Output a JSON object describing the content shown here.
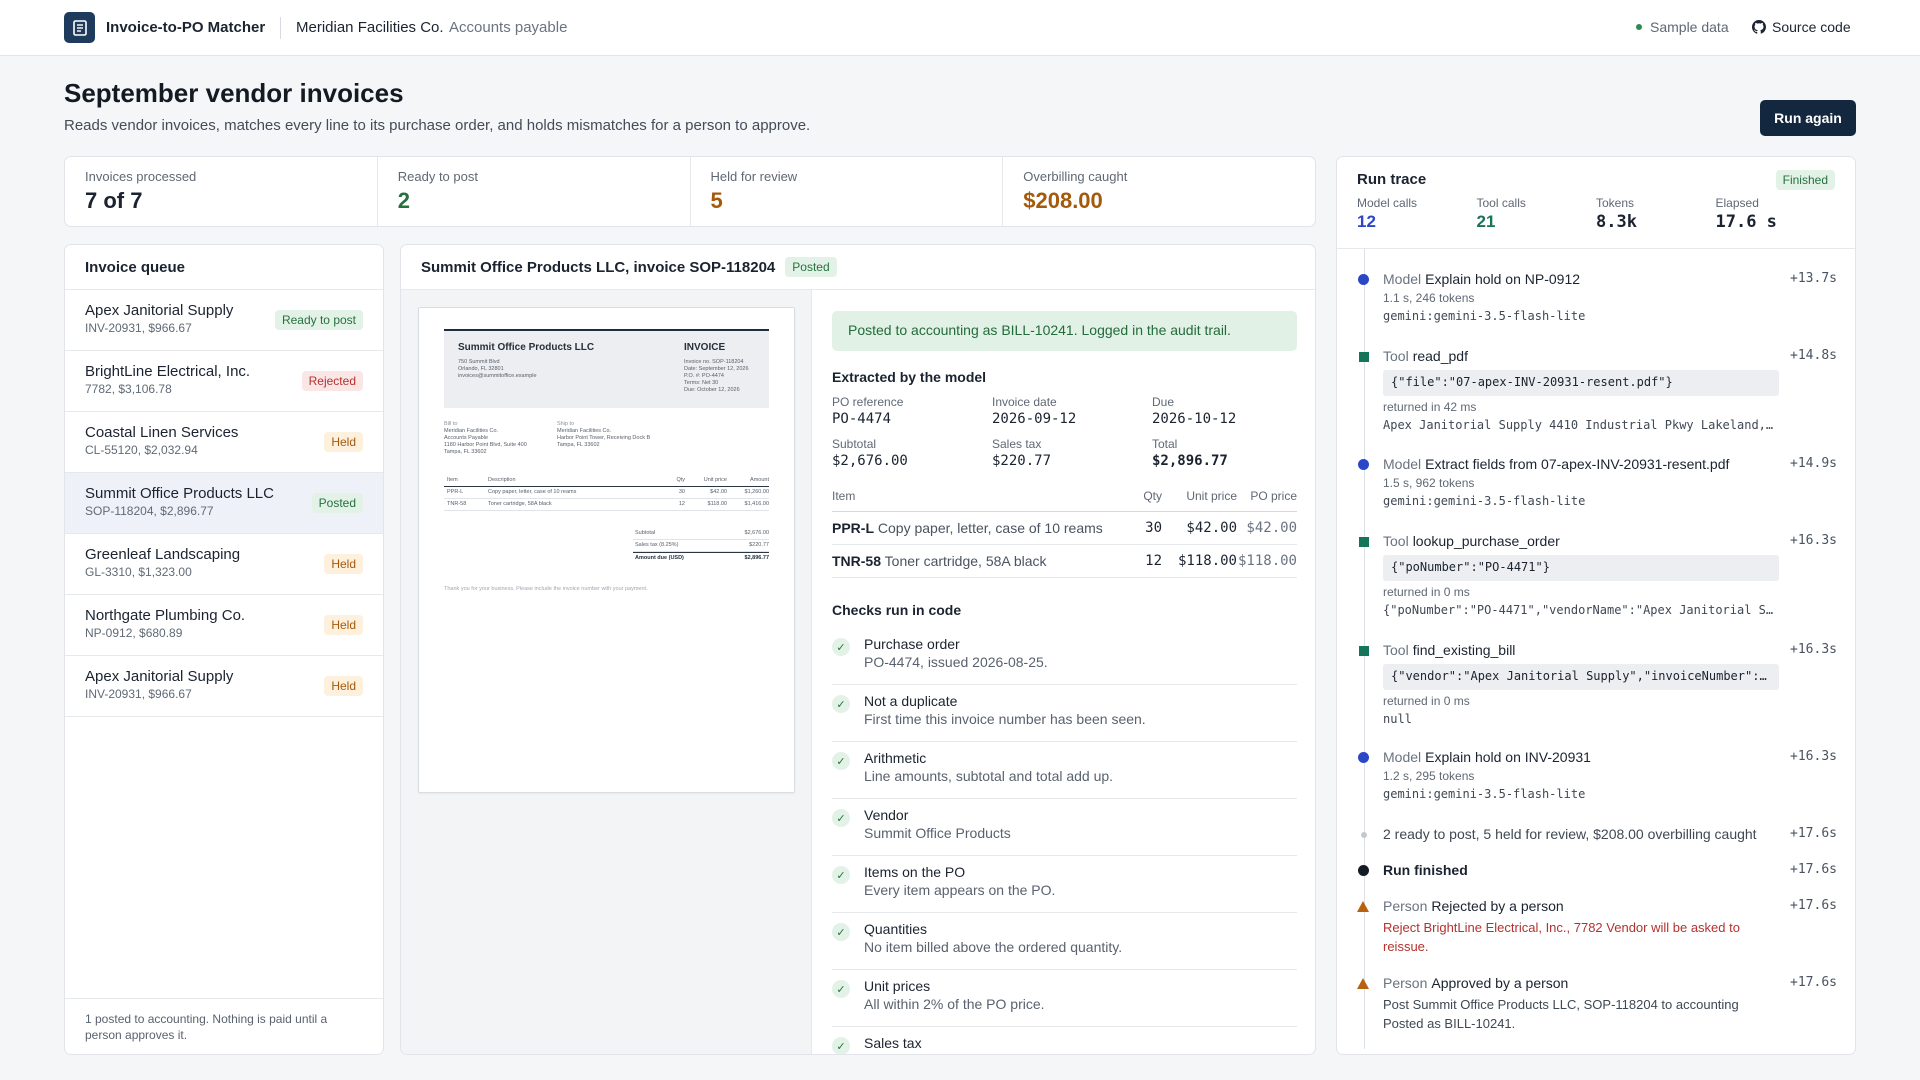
{
  "app": {
    "name": "Invoice-to-PO Matcher",
    "company": "Meridian Facilities Co.",
    "dept": "Accounts payable",
    "sample": "Sample data",
    "source": "Source code"
  },
  "header": {
    "title": "September vendor invoices",
    "subtitle": "Reads vendor invoices, matches every line to its purchase order, and holds mismatches for a person to approve.",
    "run_again": "Run again"
  },
  "stats": [
    {
      "label": "Invoices processed",
      "value": "7 of 7",
      "color": "#1b2330"
    },
    {
      "label": "Ready to post",
      "value": "2",
      "color": "#27703f"
    },
    {
      "label": "Held for review",
      "value": "5",
      "color": "#a5590b"
    },
    {
      "label": "Overbilling caught",
      "value": "$208.00",
      "color": "#a5590b"
    }
  ],
  "queue": {
    "title": "Invoice queue",
    "items": [
      {
        "name": "Apex Janitorial Supply",
        "meta": "INV-20931, $966.67",
        "status": "Ready to post"
      },
      {
        "name": "BrightLine Electrical, Inc.",
        "meta": "7782, $3,106.78",
        "status": "Rejected"
      },
      {
        "name": "Coastal Linen Services",
        "meta": "CL-55120, $2,032.94",
        "status": "Held"
      },
      {
        "name": "Summit Office Products LLC",
        "meta": "SOP-118204, $2,896.77",
        "status": "Posted"
      },
      {
        "name": "Greenleaf Landscaping",
        "meta": "GL-3310, $1,323.00",
        "status": "Held"
      },
      {
        "name": "Northgate Plumbing Co.",
        "meta": "NP-0912, $680.89",
        "status": "Held"
      },
      {
        "name": "Apex Janitorial Supply",
        "meta": "INV-20931, $966.67",
        "status": "Held"
      }
    ],
    "footer": "1 posted to accounting. Nothing is paid until a person approves it."
  },
  "detail": {
    "title": "Summit Office Products LLC, invoice SOP-118204",
    "status": "Posted",
    "alert": "Posted to accounting as BILL-10241. Logged in the audit trail.",
    "extracted_title": "Extracted by the model",
    "fields": [
      {
        "label": "PO reference",
        "value": "PO-4474"
      },
      {
        "label": "Invoice date",
        "value": "2026-09-12"
      },
      {
        "label": "Due",
        "value": "2026-10-12"
      },
      {
        "label": "Subtotal",
        "value": "$2,676.00"
      },
      {
        "label": "Sales tax",
        "value": "$220.77"
      },
      {
        "label": "Total",
        "value": "$2,896.77"
      }
    ],
    "table_headers": {
      "item": "Item",
      "qty": "Qty",
      "unit": "Unit price",
      "po": "PO price"
    },
    "items": [
      {
        "code": "PPR-L",
        "desc": "Copy paper, letter, case of 10 reams",
        "qty": "30",
        "unit": "$42.00",
        "po": "$42.00"
      },
      {
        "code": "TNR-58",
        "desc": "Toner cartridge, 58A black",
        "qty": "12",
        "unit": "$118.00",
        "po": "$118.00"
      }
    ],
    "checks_title": "Checks run in code",
    "checks": [
      {
        "title": "Purchase order",
        "desc": "PO-4474, issued 2026-08-25."
      },
      {
        "title": "Not a duplicate",
        "desc": "First time this invoice number has been seen."
      },
      {
        "title": "Arithmetic",
        "desc": "Line amounts, subtotal and total add up."
      },
      {
        "title": "Vendor",
        "desc": "Summit Office Products"
      },
      {
        "title": "Items on the PO",
        "desc": "Every item appears on the PO."
      },
      {
        "title": "Quantities",
        "desc": "No item billed above the ordered quantity."
      },
      {
        "title": "Unit prices",
        "desc": "All within 2% of the PO price."
      },
      {
        "title": "Sales tax",
        "desc": ""
      }
    ]
  },
  "document": {
    "vendor": "Summit Office Products LLC",
    "addr1": "750 Summit Blvd",
    "addr2": "Orlando, FL 32801",
    "addr3": "invoices@summitoffice.example",
    "heading": "INVOICE",
    "meta1": "Invoice no. SOP-118204",
    "meta2": "Date: September 12, 2026",
    "meta3": "P.O. #: PO-4474",
    "meta4": "Terms: Net 30",
    "meta5": "Due: October 12, 2026",
    "bill_label": "Bill to",
    "bill1": "Meridian Facilities Co.",
    "bill2": "Accounts Payable",
    "bill3": "1180 Harbor Point Blvd, Suite 400",
    "bill4": "Tampa, FL 33602",
    "ship_label": "Ship to",
    "ship1": "Meridian Facilities Co.",
    "ship2": "Harbor Point Tower, Receiving Dock B",
    "ship3": "Tampa, FL 33602",
    "col_item": "Item",
    "col_desc": "Description",
    "col_qty": "Qty",
    "col_unit": "Unit price",
    "col_amt": "Amount",
    "lines": [
      {
        "item": "PPR-L",
        "desc": "Copy paper, letter, case of 10 reams",
        "qty": "30",
        "unit": "$42.00",
        "amt": "$1,260.00"
      },
      {
        "item": "TNR-58",
        "desc": "Toner cartridge, 58A black",
        "qty": "12",
        "unit": "$118.00",
        "amt": "$1,416.00"
      }
    ],
    "subtotal_label": "Subtotal",
    "subtotal": "$2,676.00",
    "tax_label": "Sales tax (8.25%)",
    "tax": "$220.77",
    "due_label": "Amount due (USD)",
    "due": "$2,896.77",
    "thanks": "Thank you for your business. Please include the invoice number with your payment."
  },
  "trace": {
    "title": "Run trace",
    "status": "Finished",
    "stats": [
      {
        "label": "Model calls",
        "value": "12",
        "color": "#2a47c9"
      },
      {
        "label": "Tool calls",
        "value": "21",
        "color": "#16745a"
      },
      {
        "label": "Tokens",
        "value": "8.3k",
        "color": "#1b2330"
      },
      {
        "label": "Elapsed",
        "value": "17.6 s",
        "color": "#1b2330"
      }
    ],
    "events": [
      {
        "kind": "Model",
        "title": "Explain hold on NP-0912",
        "time": "+13.7s",
        "sub": "1.1 s, 246 tokens",
        "out": "gemini:gemini-3.5-flash-lite"
      },
      {
        "kind": "Tool",
        "title": "read_pdf",
        "time": "+14.8s",
        "code": "{\"file\":\"07-apex-INV-20931-resent.pdf\"}",
        "sub": "returned in 42 ms",
        "out": "Apex Janitorial Supply 4410 Industrial Pkwy Lakeland,…"
      },
      {
        "kind": "Model",
        "title": "Extract fields from 07-apex-INV-20931-resent.pdf",
        "time": "+14.9s",
        "sub": "1.5 s, 962 tokens",
        "out": "gemini:gemini-3.5-flash-lite"
      },
      {
        "kind": "Tool",
        "title": "lookup_purchase_order",
        "time": "+16.3s",
        "code": "{\"poNumber\":\"PO-4471\"}",
        "sub": "returned in 0 ms",
        "out": "{\"poNumber\":\"PO-4471\",\"vendorName\":\"Apex Janitorial S…"
      },
      {
        "kind": "Tool",
        "title": "find_existing_bill",
        "time": "+16.3s",
        "code": "{\"vendor\":\"Apex Janitorial Supply\",\"invoiceNumber\":…",
        "sub": "returned in 0 ms",
        "out": "null"
      },
      {
        "kind": "Model",
        "title": "Explain hold on INV-20931",
        "time": "+16.3s",
        "sub": "1.2 s, 295 tokens",
        "out": "gemini:gemini-3.5-flash-lite"
      },
      {
        "kind": "",
        "title": "2 ready to post, 5 held for review, $208.00 overbilling caught",
        "time": "+17.6s"
      },
      {
        "kind": "",
        "title": "Run finished",
        "time": "+17.6s"
      },
      {
        "kind": "Person",
        "title": "Rejected by a person",
        "time": "+17.6s",
        "note": "Reject BrightLine Electrical, Inc., 7782 Vendor will be asked to reissue."
      },
      {
        "kind": "Person",
        "title": "Approved by a person",
        "time": "+17.6s",
        "note1": "Post Summit Office Products LLC, SOP-118204 to accounting",
        "note2": "Posted as BILL-10241."
      }
    ]
  }
}
